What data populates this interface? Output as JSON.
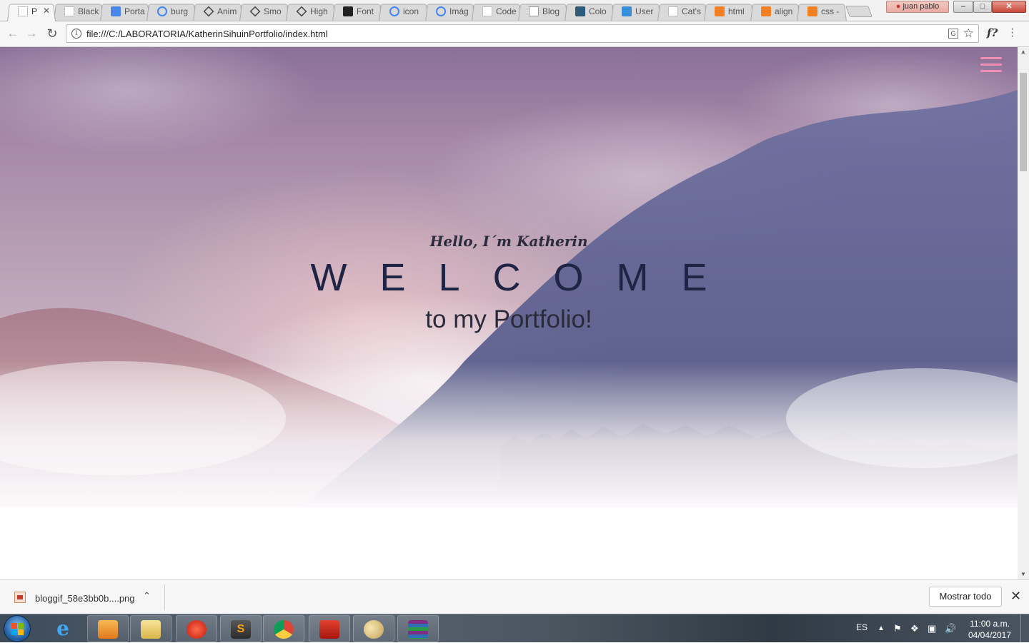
{
  "browser": {
    "tabs": [
      {
        "title": "P",
        "icon": "page-icon",
        "active": true
      },
      {
        "title": "Black",
        "icon": "page-icon"
      },
      {
        "title": "Porta",
        "icon": "google-docs-icon"
      },
      {
        "title": "burg",
        "icon": "google-icon"
      },
      {
        "title": "Anim",
        "icon": "codepen-icon"
      },
      {
        "title": "Smo",
        "icon": "codepen-icon"
      },
      {
        "title": "High",
        "icon": "codepen-icon"
      },
      {
        "title": "Font",
        "icon": "flag-icon"
      },
      {
        "title": "icon",
        "icon": "google-icon"
      },
      {
        "title": "Imág",
        "icon": "google-icon"
      },
      {
        "title": "Code",
        "icon": "page-icon"
      },
      {
        "title": "Blog",
        "icon": "star-icon"
      },
      {
        "title": "Colo",
        "icon": "pen-icon"
      },
      {
        "title": "User",
        "icon": "check-icon"
      },
      {
        "title": "Cat's",
        "icon": "page-icon"
      },
      {
        "title": "html",
        "icon": "stack-icon"
      },
      {
        "title": "align",
        "icon": "stack-icon"
      },
      {
        "title": "css -",
        "icon": "stack-icon"
      }
    ],
    "user_name": "juan pablo",
    "address_url": "file:///C:/LABORATORIA/KatherinSihuinPortfolio/index.html"
  },
  "page": {
    "greeting": "Hello, I´m Katherin",
    "welcome": "WELCOME",
    "subtitle": "to my Portfolio!",
    "menu_color": "#ef8fb6"
  },
  "download_shelf": {
    "file_name": "bloggif_58e3bb0b....png",
    "show_all_label": "Mostrar todo"
  },
  "taskbar": {
    "language": "ES",
    "time": "11:00 a.m.",
    "date": "04/04/2017",
    "apps": [
      "start-orb",
      "internet-explorer",
      "media-player",
      "file-explorer",
      "app-red",
      "sublime-text",
      "chrome",
      "acrobat-reader",
      "paint",
      "winrar"
    ]
  }
}
